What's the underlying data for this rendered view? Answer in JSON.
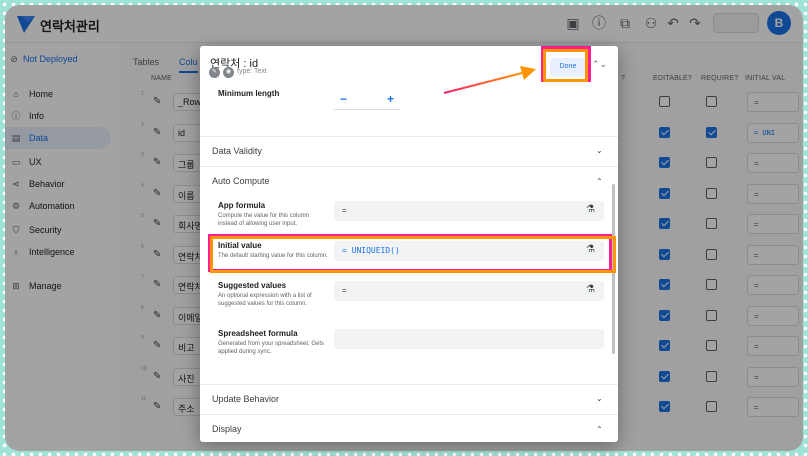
{
  "app": {
    "title": "연락처관리",
    "avatar_letter": "B"
  },
  "sidebar": {
    "status": "Not Deployed",
    "items": [
      {
        "label": "Home",
        "icon": "home-icon"
      },
      {
        "label": "Info",
        "icon": "info-icon"
      },
      {
        "label": "Data",
        "icon": "data-icon",
        "active": true
      },
      {
        "label": "UX",
        "icon": "ux-icon"
      },
      {
        "label": "Behavior",
        "icon": "behavior-icon"
      },
      {
        "label": "Automation",
        "icon": "automation-icon"
      },
      {
        "label": "Security",
        "icon": "security-icon"
      },
      {
        "label": "Intelligence",
        "icon": "intelligence-icon"
      },
      {
        "label": "Manage",
        "icon": "manage-icon"
      }
    ]
  },
  "main": {
    "tabs": [
      "Tables",
      "Colu"
    ],
    "columns": [
      "NAME",
      "?",
      "EDITABLE?",
      "REQUIRE?",
      "INITIAL VAL"
    ],
    "rows": [
      {
        "num": "1",
        "name": "_RowNu",
        "editable": false,
        "require": false,
        "initial": "="
      },
      {
        "num": "2",
        "name": "id",
        "editable": true,
        "require": true,
        "initial": "= UNI"
      },
      {
        "num": "3",
        "name": "그룹",
        "editable": true,
        "require": false,
        "initial": "="
      },
      {
        "num": "4",
        "name": "이름",
        "editable": true,
        "require": false,
        "initial": "="
      },
      {
        "num": "5",
        "name": "회사명",
        "editable": true,
        "require": false,
        "initial": "="
      },
      {
        "num": "6",
        "name": "연락처",
        "editable": true,
        "require": false,
        "initial": "="
      },
      {
        "num": "7",
        "name": "연락처2",
        "editable": true,
        "require": false,
        "initial": "="
      },
      {
        "num": "8",
        "name": "이메일",
        "editable": true,
        "require": false,
        "initial": "="
      },
      {
        "num": "9",
        "name": "비고",
        "editable": true,
        "require": false,
        "initial": "="
      },
      {
        "num": "10",
        "name": "사진",
        "editable": true,
        "require": false,
        "initial": "="
      },
      {
        "num": "11",
        "name": "주소",
        "editable": true,
        "require": false,
        "initial": "="
      }
    ]
  },
  "dialog": {
    "title": "연락처 : id",
    "type_label": "type: Text",
    "done_label": "Done",
    "min_length_label": "Minimum length",
    "stepper_minus": "−",
    "stepper_plus": "+",
    "sections": {
      "data_validity": "Data Validity",
      "auto_compute": "Auto Compute",
      "update_behavior": "Update Behavior",
      "display": "Display"
    },
    "fields": {
      "app_formula": {
        "title": "App formula",
        "desc": "Compute the value for this column instead of allowing user input.",
        "value": "="
      },
      "initial_value": {
        "title": "Initial value",
        "desc": "The default starting value for this column.",
        "value": "= UNIQUEID()"
      },
      "suggested_values": {
        "title": "Suggested values",
        "desc": "An optional expression with a list of suggested values for this column.",
        "value": "="
      },
      "spreadsheet_formula": {
        "title": "Spreadsheet formula",
        "desc": "Generated from your spreadsheet. Gets applied during sync.",
        "value": ""
      }
    }
  },
  "colors": {
    "accent": "#1a73e8",
    "highlight_pink": "#ff1f8e",
    "highlight_orange": "#ff9500",
    "arrow": "#ff3d6e"
  }
}
